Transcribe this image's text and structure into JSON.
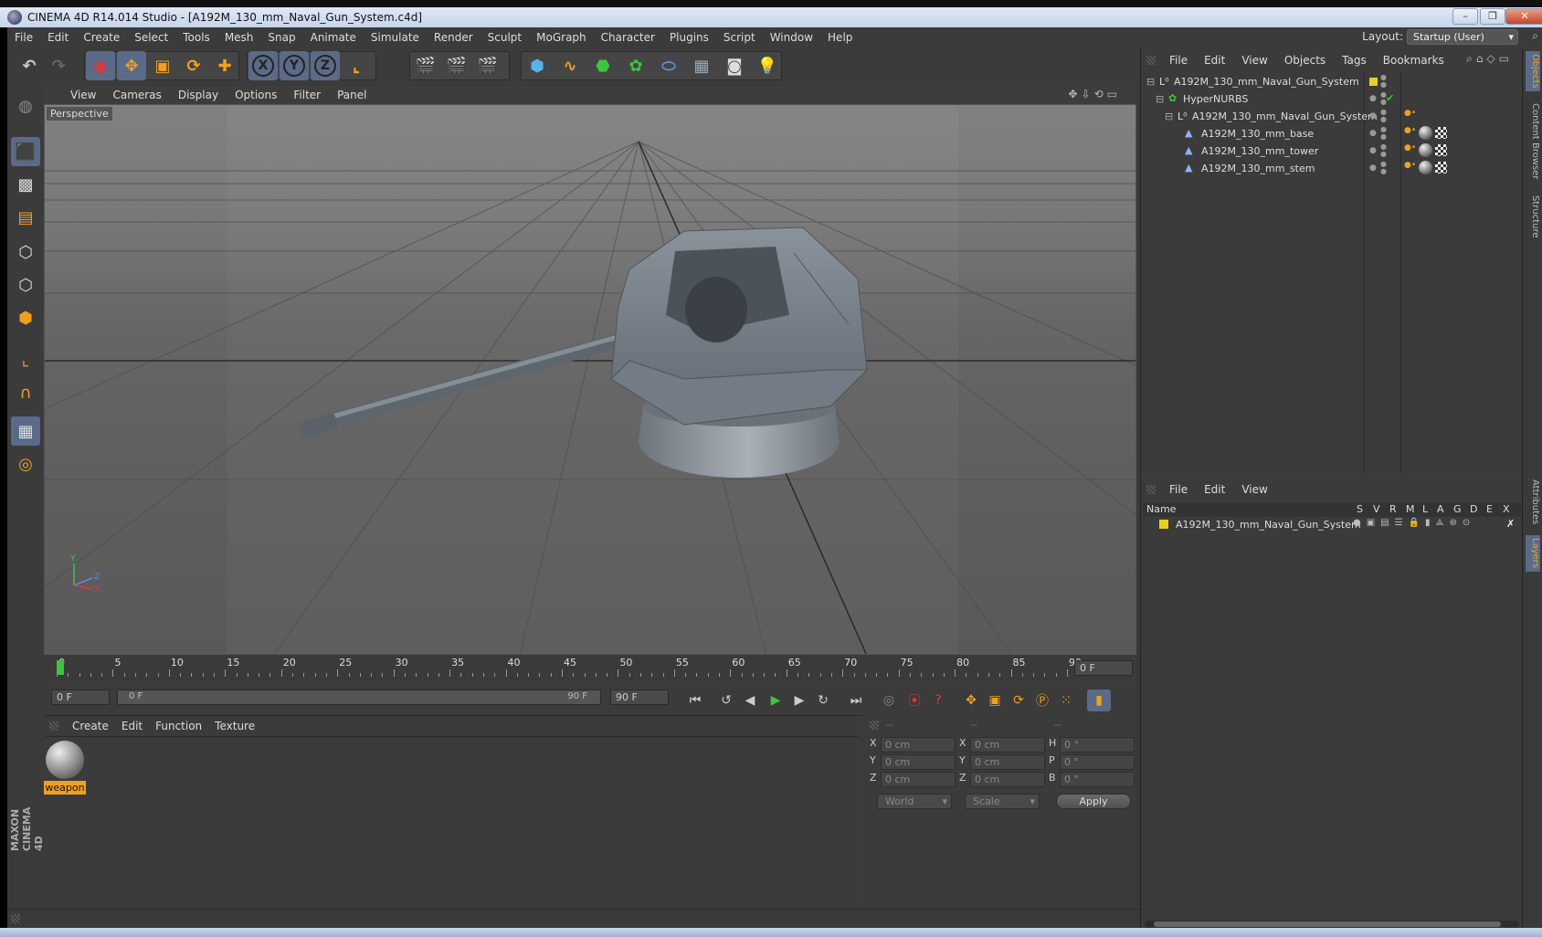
{
  "window": {
    "title": "CINEMA 4D R14.014 Studio - [A192M_130_mm_Naval_Gun_System.c4d]",
    "minimize": "–",
    "restore": "❐",
    "close": "✕"
  },
  "menubar": {
    "items": [
      "File",
      "Edit",
      "Create",
      "Select",
      "Tools",
      "Mesh",
      "Snap",
      "Animate",
      "Simulate",
      "Render",
      "Sculpt",
      "MoGraph",
      "Character",
      "Plugins",
      "Script",
      "Window",
      "Help"
    ],
    "layout_label": "Layout:",
    "layout_value": "Startup (User)"
  },
  "viewport": {
    "menu": [
      "View",
      "Cameras",
      "Display",
      "Options",
      "Filter",
      "Panel"
    ],
    "label": "Perspective",
    "axis_y": "Y",
    "axis_z": "Z",
    "axis_x": "X"
  },
  "timeline": {
    "ticks": [
      "0",
      "5",
      "10",
      "15",
      "20",
      "25",
      "30",
      "35",
      "40",
      "45",
      "50",
      "55",
      "60",
      "65",
      "70",
      "75",
      "80",
      "85",
      "90"
    ],
    "current_frame": "0 F",
    "start_field": "0 F",
    "range_start": "0 F",
    "range_end": "90 F",
    "end_field": "90 F"
  },
  "material_panel": {
    "menu": [
      "Create",
      "Edit",
      "Function",
      "Texture"
    ],
    "material_name": "weapon"
  },
  "coord_panel": {
    "headers": [
      "--",
      "--",
      "--"
    ],
    "rows": [
      {
        "l1": "X",
        "v1": "0 cm",
        "l2": "X",
        "v2": "0 cm",
        "l3": "H",
        "v3": "0 °"
      },
      {
        "l1": "Y",
        "v1": "0 cm",
        "l2": "Y",
        "v2": "0 cm",
        "l3": "P",
        "v3": "0 °"
      },
      {
        "l1": "Z",
        "v1": "0 cm",
        "l2": "Z",
        "v2": "0 cm",
        "l3": "B",
        "v3": "0 °"
      }
    ],
    "world": "World",
    "scale": "Scale",
    "apply": "Apply"
  },
  "object_manager": {
    "menu": [
      "File",
      "Edit",
      "View",
      "Objects",
      "Tags",
      "Bookmarks"
    ],
    "objects": [
      {
        "name": "A192M_130_mm_Naval_Gun_System"
      },
      {
        "name": "HyperNURBS"
      },
      {
        "name": "A192M_130_mm_Naval_Gun_System"
      },
      {
        "name": "A192M_130_mm_base"
      },
      {
        "name": "A192M_130_mm_tower"
      },
      {
        "name": "A192M_130_mm_stem"
      }
    ]
  },
  "layer_manager": {
    "menu": [
      "File",
      "Edit",
      "View"
    ],
    "name_header": "Name",
    "columns": [
      "S",
      "V",
      "R",
      "M",
      "L",
      "A",
      "G",
      "D",
      "E",
      "X"
    ],
    "layer_name": "A192M_130_mm_Naval_Gun_System"
  },
  "right_tabs": [
    "Objects",
    "Content Browser",
    "Structure",
    "Attributes",
    "Layers"
  ],
  "branding": "MAXON CINEMA 4D",
  "colors": {
    "accent_orange": "#f0a020",
    "layer_yellow": "#e6d21e",
    "play_green": "#3ec43e"
  }
}
